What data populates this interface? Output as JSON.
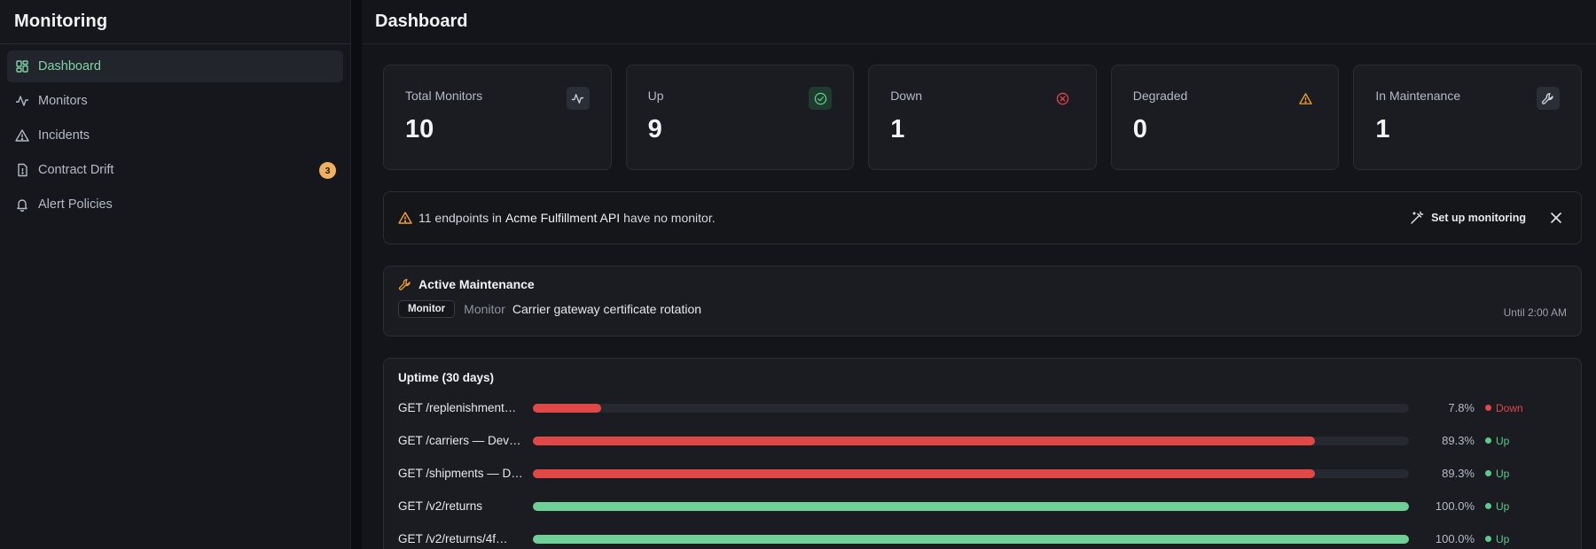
{
  "app": {
    "title": "Monitoring"
  },
  "sidebar": {
    "items": [
      {
        "label": "Dashboard",
        "icon": "dashboard-icon",
        "active": true
      },
      {
        "label": "Monitors",
        "icon": "activity-icon"
      },
      {
        "label": "Incidents",
        "icon": "alert-triangle-icon"
      },
      {
        "label": "Contract Drift",
        "icon": "file-alert-icon",
        "badge": "3"
      },
      {
        "label": "Alert Policies",
        "icon": "bell-icon"
      }
    ]
  },
  "page": {
    "title": "Dashboard"
  },
  "stats": [
    {
      "label": "Total Monitors",
      "value": "10",
      "icon": "activity-icon"
    },
    {
      "label": "Up",
      "value": "9",
      "icon": "check-circle-icon"
    },
    {
      "label": "Down",
      "value": "1",
      "icon": "x-circle-icon"
    },
    {
      "label": "Degraded",
      "value": "0",
      "icon": "alert-triangle-icon"
    },
    {
      "label": "In Maintenance",
      "value": "1",
      "icon": "wrench-icon"
    }
  ],
  "banner": {
    "prefix": "11 endpoints in",
    "api_name": "Acme Fulfillment API",
    "suffix": "have no monitor.",
    "action_label": "Set up monitoring"
  },
  "maintenance": {
    "title": "Active Maintenance",
    "chip": "Monitor",
    "kind": "Monitor",
    "name": "Carrier gateway certificate rotation",
    "until": "Until 2:00 AM"
  },
  "uptime": {
    "title": "Uptime (30 days)",
    "rows": [
      {
        "name": "GET /replenishment…",
        "pct": 7.8,
        "pct_label": "7.8%",
        "status": "Down"
      },
      {
        "name": "GET /carriers — Dev…",
        "pct": 89.3,
        "pct_label": "89.3%",
        "status": "Up"
      },
      {
        "name": "GET /shipments — D…",
        "pct": 89.3,
        "pct_label": "89.3%",
        "status": "Up"
      },
      {
        "name": "GET /v2/returns",
        "pct": 100.0,
        "pct_label": "100.0%",
        "status": "Up"
      },
      {
        "name": "GET /v2/returns/4f…",
        "pct": 100.0,
        "pct_label": "100.0%",
        "status": "Up"
      }
    ]
  },
  "colors": {
    "accent": "#7fd3a6",
    "up": "#5ccb8a",
    "down": "#e04848",
    "bar_green": "#6fcf97",
    "amber": "#f0a030"
  }
}
